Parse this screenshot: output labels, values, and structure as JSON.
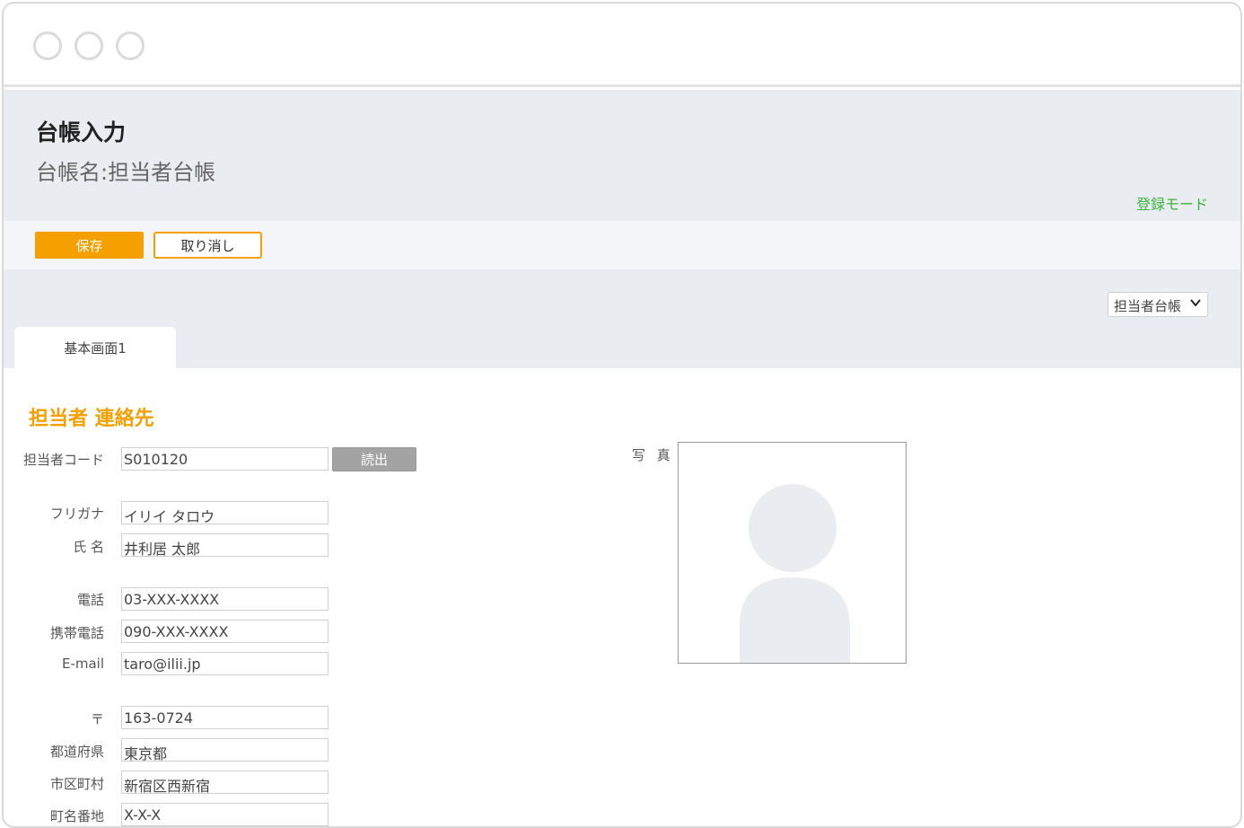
{
  "page": {
    "title": "台帳入力",
    "subtitle": "台帳名:担当者台帳",
    "mode": "登録モード"
  },
  "toolbar": {
    "save_label": "保存",
    "cancel_label": "取り消し"
  },
  "ledger_select": {
    "value": "担当者台帳"
  },
  "tabs": [
    {
      "label": "基本画面1"
    }
  ],
  "section": {
    "title": "担当者 連絡先"
  },
  "form": {
    "code": {
      "label": "担当者コード",
      "value": "S010120"
    },
    "read_button": "読出",
    "furigana": {
      "label": "フリガナ",
      "value": "イリイ タロウ"
    },
    "name": {
      "label": "氏 名",
      "value": "井利居 太郎"
    },
    "phone": {
      "label": "電話",
      "value": "03-XXX-XXXX"
    },
    "mobile": {
      "label": "携帯電話",
      "value": "090-XXX-XXXX"
    },
    "email": {
      "label": "E-mail",
      "value": "taro@ilii.jp"
    },
    "postal": {
      "label": "〒",
      "value": "163-0724"
    },
    "prefecture": {
      "label": "都道府県",
      "value": "東京都"
    },
    "city": {
      "label": "市区町村",
      "value": "新宿区西新宿"
    },
    "address": {
      "label": "町名番地",
      "value": "X-X-X"
    }
  },
  "photo": {
    "label": "写 真"
  },
  "colors": {
    "accent": "#f5a000",
    "mode_green": "#3cb43c",
    "header_bg": "#e9ecf0"
  }
}
